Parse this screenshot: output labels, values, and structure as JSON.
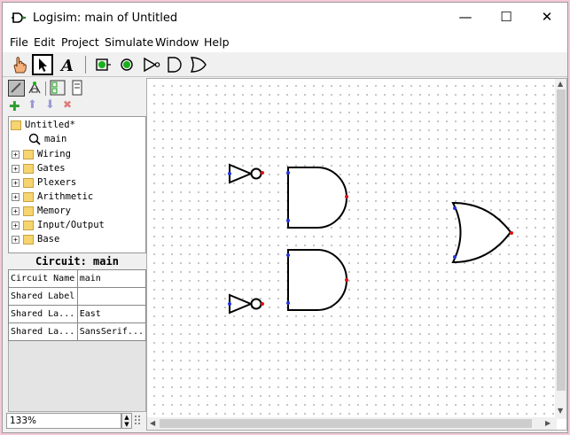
{
  "window": {
    "title": "Logisim: main of Untitled",
    "controls": {
      "minimize": "—",
      "maximize": "☐",
      "close": "✕"
    }
  },
  "menu": [
    "File",
    "Edit",
    "Project",
    "Simulate",
    "Window",
    "Help"
  ],
  "toolbar": {
    "tools": [
      "poke-tool-icon",
      "select-tool-icon",
      "text-tool-icon",
      "input-pin-icon",
      "output-pin-icon",
      "not-gate-icon",
      "and-gate-icon",
      "or-gate-icon"
    ],
    "selected_tool": "select-tool-icon"
  },
  "project_toolbar": {
    "icons": [
      "layout-edit-icon",
      "appearance-edit-icon",
      "toggle-toolbox-icon",
      "toggle-attributes-icon"
    ],
    "actions": [
      {
        "icon": "add-circuit-icon",
        "glyph": "✚",
        "color": "#2e9d2e"
      },
      {
        "icon": "move-up-icon",
        "glyph": "⬆",
        "color": "#9a9ad8"
      },
      {
        "icon": "move-down-icon",
        "glyph": "⬇",
        "color": "#9a9ad8"
      },
      {
        "icon": "delete-circuit-icon",
        "glyph": "✖",
        "color": "#e07a7a"
      }
    ]
  },
  "tree": {
    "project": "Untitled*",
    "circuit": "main",
    "libraries": [
      "Wiring",
      "Gates",
      "Plexers",
      "Arithmetic",
      "Memory",
      "Input/Output",
      "Base"
    ]
  },
  "attributes": {
    "title": "Circuit: main",
    "rows": [
      {
        "label": "Circuit Name",
        "value": "main"
      },
      {
        "label": "Shared Label",
        "value": ""
      },
      {
        "label": "Shared La...",
        "value": "East"
      },
      {
        "label": "Shared La...",
        "value": "SansSerif..."
      }
    ]
  },
  "zoom": "133%",
  "colors": {
    "pin_input": "#2233dd",
    "pin_output": "#dd1111",
    "gate_stroke": "#000000"
  }
}
